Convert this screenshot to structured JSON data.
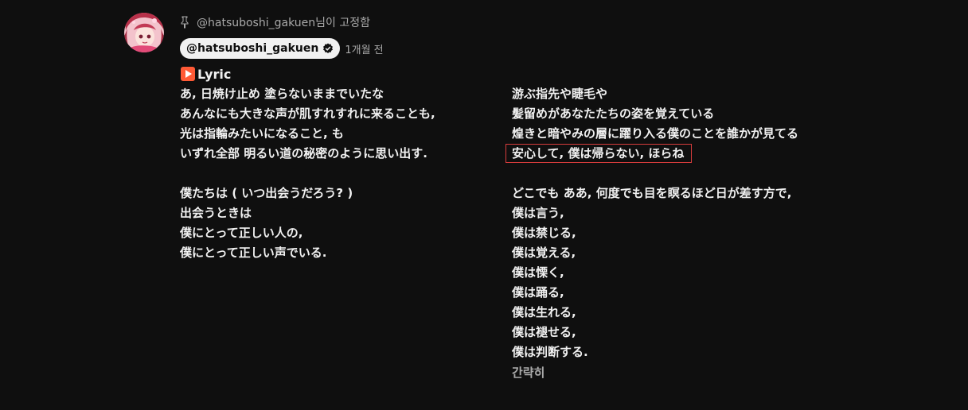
{
  "comment": {
    "pinned_text": "@hatsuboshi_gakuen님이 고정함",
    "author": "@hatsuboshi_gakuen",
    "timestamp": "1개월 전",
    "lyric_label": "Lyric",
    "collapse_label": "간략히"
  },
  "lyrics_left": {
    "stanza1": [
      "あ, 日焼け止め 塗らないままでいたな",
      "あんなにも大きな声が肌すれすれに来ることも,",
      "光は指輪みたいになること, も",
      "いずれ全部 明るい道の秘密のように思い出す."
    ],
    "stanza2": [
      "僕たちは ( いつ出会うだろう? )",
      "出会うときは",
      "僕にとって正しい人の,",
      "僕にとって正しい声でいる."
    ]
  },
  "lyrics_right": {
    "stanza1": [
      "游ぶ指先や睫毛や",
      "髪留めがあなたたちの姿を覚えている",
      "煌きと暗やみの層に躍り入る僕のことを誰かが見てる",
      "安心して, 僕は帰らない, ほらね"
    ],
    "stanza2": [
      "どこでも ああ, 何度でも目を瞑るほど日が差す方で,",
      "僕は言う,",
      "僕は禁じる,",
      "僕は覚える,",
      "僕は慄く,",
      "僕は踊る,",
      "僕は生れる,",
      "僕は褪せる,",
      "僕は判断する."
    ]
  },
  "colors": {
    "background": "#0f0f0f",
    "text": "#f1f1f1",
    "secondary_text": "#aaaaaa",
    "highlight_border": "#d63c3c",
    "play_icon": "#ff5a36"
  },
  "icons": [
    "avatar",
    "pin-icon",
    "verified-icon",
    "play-button-icon"
  ]
}
